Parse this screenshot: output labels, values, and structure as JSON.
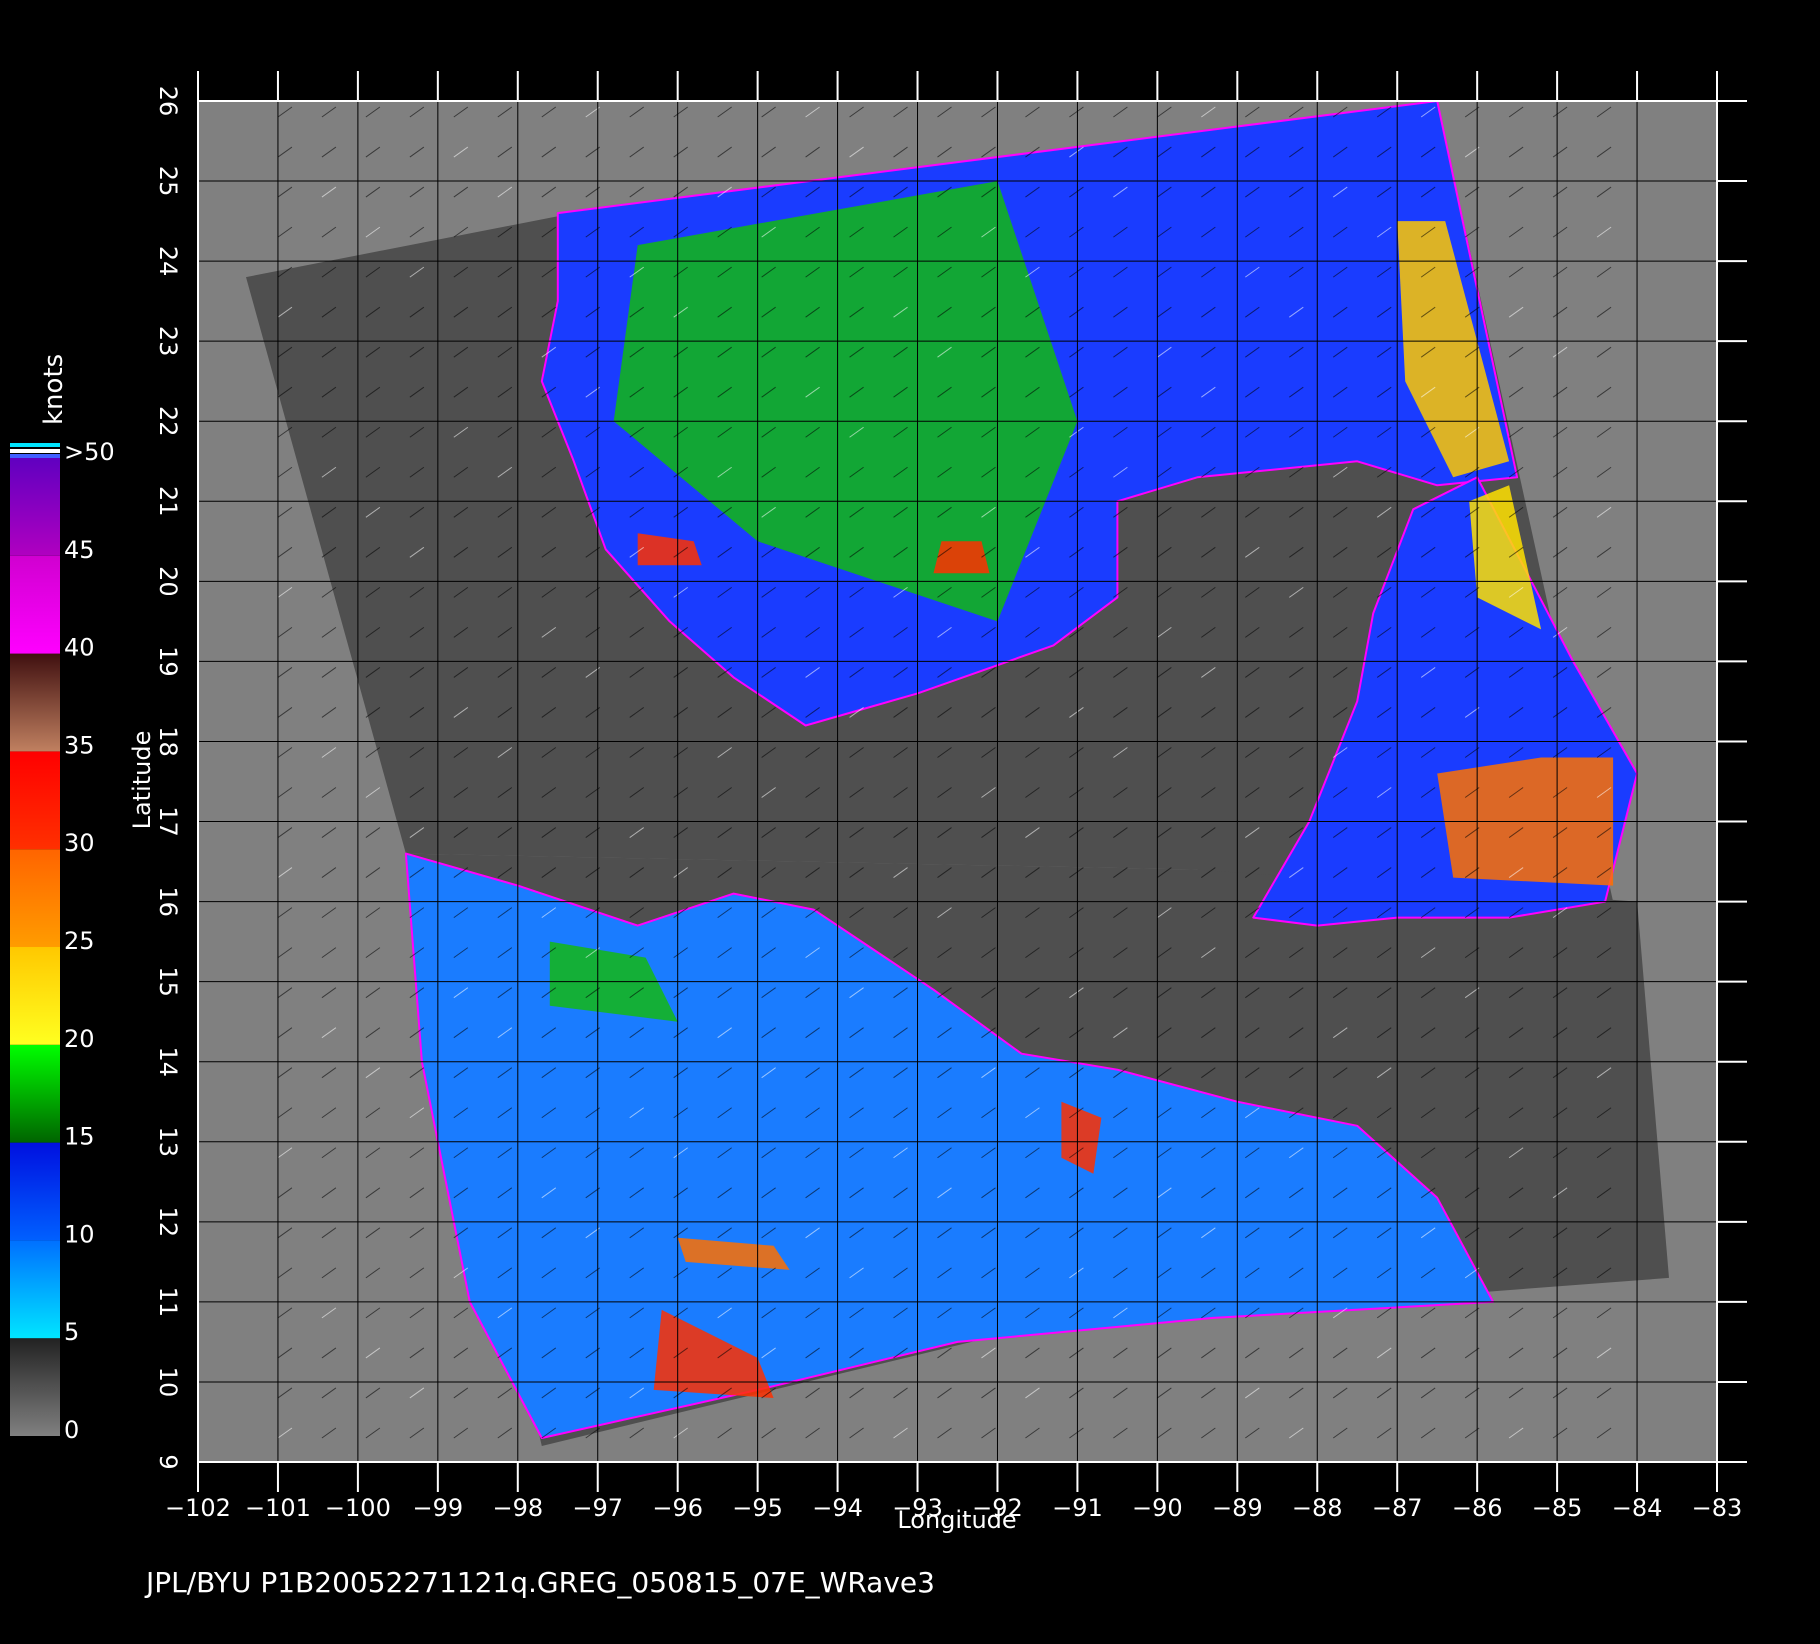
{
  "figure": {
    "caption": "JPL/BYU  P1B20052271121q.GREG_050815_07E_WRave3",
    "background": "#000000",
    "map_background": "#808080",
    "swath_land": "#4f4f4f",
    "land_mask": "#555555"
  },
  "axes": {
    "xlabel": "Longitude",
    "ylabel": "Latitude",
    "xlim": [
      -102,
      -83
    ],
    "ylim": [
      9,
      26
    ],
    "x_ticks": [
      -102,
      -101,
      -100,
      -99,
      -98,
      -97,
      -96,
      -95,
      -94,
      -93,
      -92,
      -91,
      -90,
      -89,
      -88,
      -87,
      -86,
      -85,
      -84,
      -83
    ],
    "x_tick_labels": [
      "−102",
      "−101",
      "−100",
      "−99",
      "−98",
      "−97",
      "−96",
      "−95",
      "−94",
      "−93",
      "−92",
      "−91",
      "−90",
      "−89",
      "−88",
      "−87",
      "−86",
      "−85",
      "−84",
      "−83"
    ],
    "y_ticks": [
      9,
      10,
      11,
      12,
      13,
      14,
      15,
      16,
      17,
      18,
      19,
      20,
      21,
      22,
      23,
      24,
      25,
      26
    ],
    "y_tick_labels": [
      "9",
      "10",
      "11",
      "12",
      "13",
      "14",
      "15",
      "16",
      "17",
      "18",
      "19",
      "20",
      "21",
      "22",
      "23",
      "24",
      "25",
      "26"
    ],
    "grid": true,
    "grid_color": "#000000"
  },
  "colorbar": {
    "unit_label": "knots",
    "labels": [
      "0",
      "5",
      "10",
      "15",
      "20",
      "25",
      "30",
      "35",
      "40",
      "45",
      ">50"
    ],
    "bands": [
      {
        "from": 0,
        "to": 5,
        "colors": [
          "#808080",
          "#222222"
        ]
      },
      {
        "from": 5,
        "to": 10,
        "colors": [
          "#00e5ff",
          "#0070ff"
        ]
      },
      {
        "from": 10,
        "to": 15,
        "colors": [
          "#0060ff",
          "#0010e0"
        ]
      },
      {
        "from": 15,
        "to": 20,
        "colors": [
          "#006400",
          "#00ff00"
        ]
      },
      {
        "from": 20,
        "to": 25,
        "colors": [
          "#ffff20",
          "#ffc800"
        ]
      },
      {
        "from": 25,
        "to": 30,
        "colors": [
          "#ff9c00",
          "#ff6400"
        ]
      },
      {
        "from": 30,
        "to": 35,
        "colors": [
          "#ff3000",
          "#ff0000"
        ]
      },
      {
        "from": 35,
        "to": 40,
        "colors": [
          "#c08060",
          "#401010"
        ]
      },
      {
        "from": 40,
        "to": 45,
        "colors": [
          "#ff00ff",
          "#d000d0"
        ]
      },
      {
        "from": 45,
        "to": 50,
        "colors": [
          "#b000c0",
          "#6000c0"
        ]
      }
    ]
  },
  "regions": [
    {
      "name": "gulf-of-mexico-swath",
      "color": "#1a3cff",
      "points": [
        [
          -97.5,
          24.6
        ],
        [
          -86.5,
          26.0
        ],
        [
          -85.5,
          21.3
        ],
        [
          -86.5,
          21.2
        ],
        [
          -87.5,
          21.5
        ],
        [
          -89.5,
          21.3
        ],
        [
          -90.5,
          21.0
        ],
        [
          -90.5,
          19.8
        ],
        [
          -91.3,
          19.2
        ],
        [
          -93.0,
          18.6
        ],
        [
          -94.4,
          18.2
        ],
        [
          -95.3,
          18.8
        ],
        [
          -96.1,
          19.5
        ],
        [
          -96.9,
          20.4
        ],
        [
          -97.3,
          21.5
        ],
        [
          -97.7,
          22.5
        ],
        [
          -97.5,
          23.5
        ]
      ]
    },
    {
      "name": "caribbean-swath",
      "color": "#1a3cff",
      "points": [
        [
          -86.8,
          20.9
        ],
        [
          -86.0,
          21.3
        ],
        [
          -84.8,
          19.0
        ],
        [
          -84.0,
          17.6
        ],
        [
          -84.4,
          16.0
        ],
        [
          -85.6,
          15.8
        ],
        [
          -86.3,
          15.8
        ],
        [
          -87.0,
          15.8
        ],
        [
          -88.0,
          15.7
        ],
        [
          -88.8,
          15.8
        ],
        [
          -88.1,
          17.0
        ],
        [
          -87.5,
          18.5
        ],
        [
          -87.3,
          19.6
        ]
      ]
    },
    {
      "name": "pacific-swath",
      "color": "#1a7cff",
      "points": [
        [
          -99.4,
          16.6
        ],
        [
          -98.0,
          16.2
        ],
        [
          -96.5,
          15.7
        ],
        [
          -95.3,
          16.1
        ],
        [
          -94.3,
          15.9
        ],
        [
          -92.8,
          14.9
        ],
        [
          -91.7,
          14.1
        ],
        [
          -90.5,
          13.9
        ],
        [
          -89.0,
          13.5
        ],
        [
          -87.5,
          13.2
        ],
        [
          -86.5,
          12.3
        ],
        [
          -85.8,
          11.0
        ],
        [
          -89.3,
          10.8
        ],
        [
          -92.5,
          10.5
        ],
        [
          -95.0,
          9.9
        ],
        [
          -97.7,
          9.3
        ],
        [
          -98.6,
          11.0
        ],
        [
          -99.2,
          14.0
        ]
      ]
    }
  ],
  "patches": [
    {
      "region": "gulf-green-core",
      "color": "#12b812",
      "points": [
        [
          -96.5,
          24.2
        ],
        [
          -92.0,
          25.0
        ],
        [
          -91.0,
          22.0
        ],
        [
          -92.0,
          19.5
        ],
        [
          -95.0,
          20.5
        ],
        [
          -96.8,
          22.0
        ]
      ]
    },
    {
      "region": "gulf-yellow-east",
      "color": "#ffc800",
      "points": [
        [
          -87.0,
          24.5
        ],
        [
          -86.4,
          24.5
        ],
        [
          -85.6,
          21.5
        ],
        [
          -86.3,
          21.3
        ],
        [
          -86.9,
          22.5
        ]
      ]
    },
    {
      "region": "caribbean-orange",
      "color": "#ff7000",
      "points": [
        [
          -86.5,
          17.6
        ],
        [
          -85.2,
          17.8
        ],
        [
          -84.3,
          17.8
        ],
        [
          -84.3,
          16.2
        ],
        [
          -86.3,
          16.3
        ]
      ]
    },
    {
      "region": "caribbean-yellow",
      "color": "#ffe000",
      "points": [
        [
          -86.1,
          21.0
        ],
        [
          -85.6,
          21.2
        ],
        [
          -85.2,
          19.4
        ],
        [
          -86.0,
          19.8
        ]
      ]
    },
    {
      "region": "pacific-red-south",
      "color": "#ff3000",
      "points": [
        [
          -96.2,
          10.9
        ],
        [
          -95.0,
          10.3
        ],
        [
          -94.8,
          9.8
        ],
        [
          -96.3,
          9.9
        ]
      ]
    },
    {
      "region": "pacific-orange-mid",
      "color": "#ff7000",
      "points": [
        [
          -96.0,
          11.8
        ],
        [
          -94.8,
          11.7
        ],
        [
          -94.6,
          11.4
        ],
        [
          -95.9,
          11.5
        ]
      ]
    },
    {
      "region": "pacific-green-north",
      "color": "#14b814",
      "points": [
        [
          -97.6,
          15.5
        ],
        [
          -96.4,
          15.3
        ],
        [
          -96.0,
          14.5
        ],
        [
          -97.6,
          14.7
        ]
      ]
    },
    {
      "region": "pacific-red-gulf-of-fonseca",
      "color": "#ff3000",
      "points": [
        [
          -91.2,
          13.5
        ],
        [
          -90.7,
          13.3
        ],
        [
          -90.8,
          12.6
        ],
        [
          -91.2,
          12.8
        ]
      ]
    },
    {
      "region": "gulf-red-sw",
      "color": "#ff3000",
      "points": [
        [
          -96.5,
          20.6
        ],
        [
          -95.8,
          20.5
        ],
        [
          -95.7,
          20.2
        ],
        [
          -96.5,
          20.2
        ]
      ]
    },
    {
      "region": "gulf-red-central",
      "color": "#ff3000",
      "points": [
        [
          -92.7,
          20.5
        ],
        [
          -92.2,
          20.5
        ],
        [
          -92.1,
          20.1
        ],
        [
          -92.8,
          20.1
        ]
      ]
    }
  ],
  "swath_outlines": [
    {
      "name": "swath-north",
      "points": [
        [
          -101.4,
          23.8
        ],
        [
          -97.3,
          24.6
        ],
        [
          -86.5,
          26.0
        ],
        [
          -84.3,
          16.0
        ],
        [
          -88.8,
          15.8
        ],
        [
          -89.5,
          16.4
        ],
        [
          -99.4,
          16.6
        ]
      ]
    },
    {
      "name": "swath-south",
      "points": [
        [
          -99.4,
          16.6
        ],
        [
          -89.5,
          16.4
        ],
        [
          -84.0,
          16.0
        ],
        [
          -83.6,
          11.3
        ],
        [
          -91.5,
          10.7
        ],
        [
          -97.7,
          9.2
        ]
      ]
    }
  ]
}
